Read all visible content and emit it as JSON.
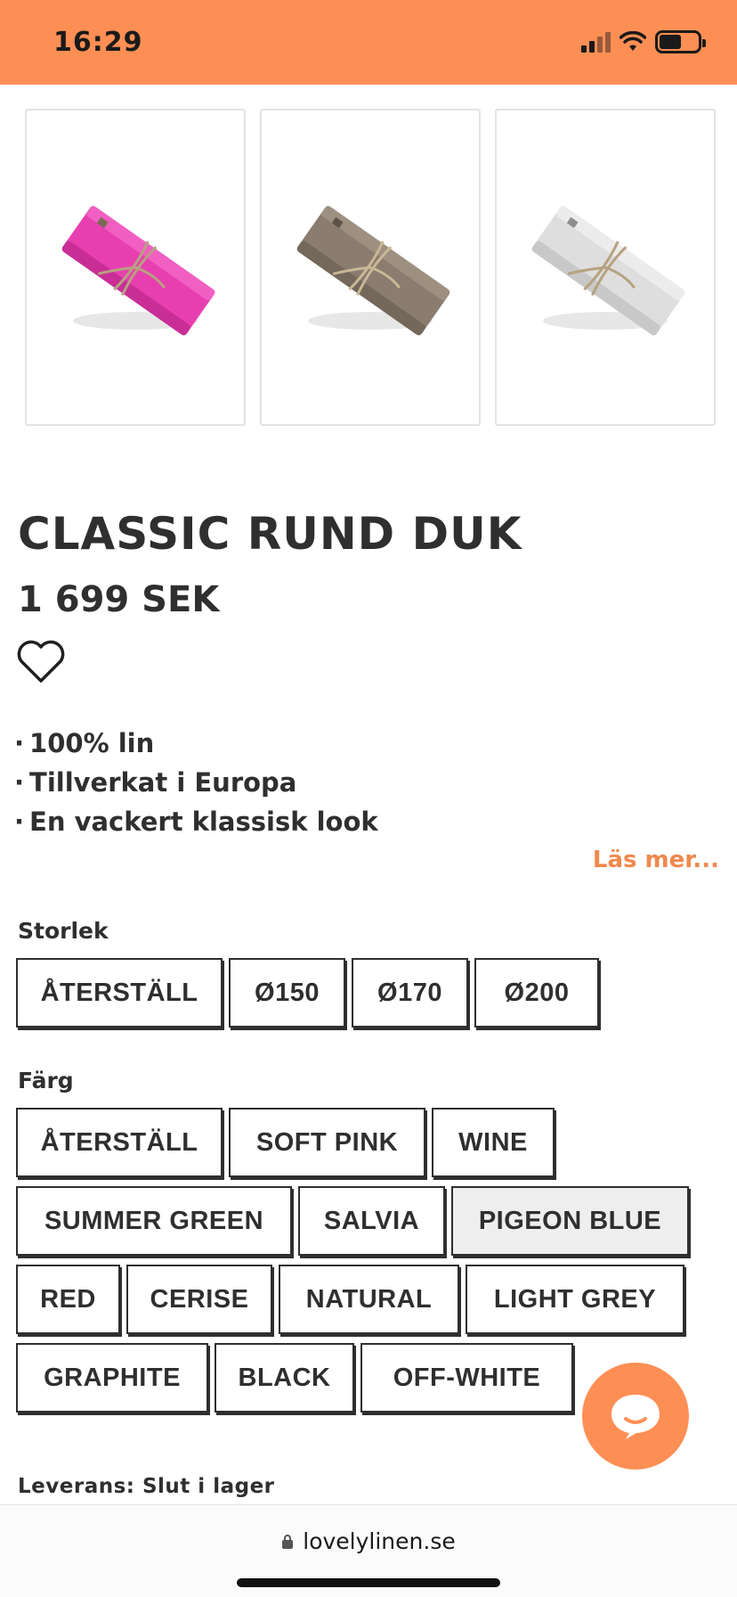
{
  "status_bar": {
    "time": "16:29",
    "background": "#fd8f55"
  },
  "thumbnails": [
    {
      "color_name": "cerise",
      "color": "#e83fb0"
    },
    {
      "color_name": "natural",
      "color": "#8a7c6e"
    },
    {
      "color_name": "light grey",
      "color": "#d9d9d9"
    }
  ],
  "product": {
    "title": "CLASSIC RUND DUK",
    "price": "1 699 SEK",
    "features": [
      "100% lin",
      "Tillverkat i Europa",
      "En vackert klassisk look"
    ],
    "read_more": "Läs mer..."
  },
  "size": {
    "label": "Storlek",
    "options": [
      "ÅTERSTÄLL",
      "Ø150",
      "Ø170",
      "Ø200"
    ]
  },
  "color": {
    "label": "Färg",
    "rows": [
      [
        "ÅTERSTÄLL",
        "SOFT PINK",
        "WINE"
      ],
      [
        "SUMMER GREEN",
        "SALVIA",
        "PIGEON BLUE"
      ],
      [
        "RED",
        "CERISE",
        "NATURAL",
        "LIGHT GREY"
      ],
      [
        "GRAPHITE",
        "BLACK",
        "OFF-WHITE"
      ]
    ],
    "selected": "PIGEON BLUE"
  },
  "delivery": "Leverans: Slut i lager",
  "browser": {
    "url": "lovelylinen.se"
  },
  "colors": {
    "accent": "#fd8f55",
    "link": "#f0884d",
    "text": "#2f2f2f"
  }
}
